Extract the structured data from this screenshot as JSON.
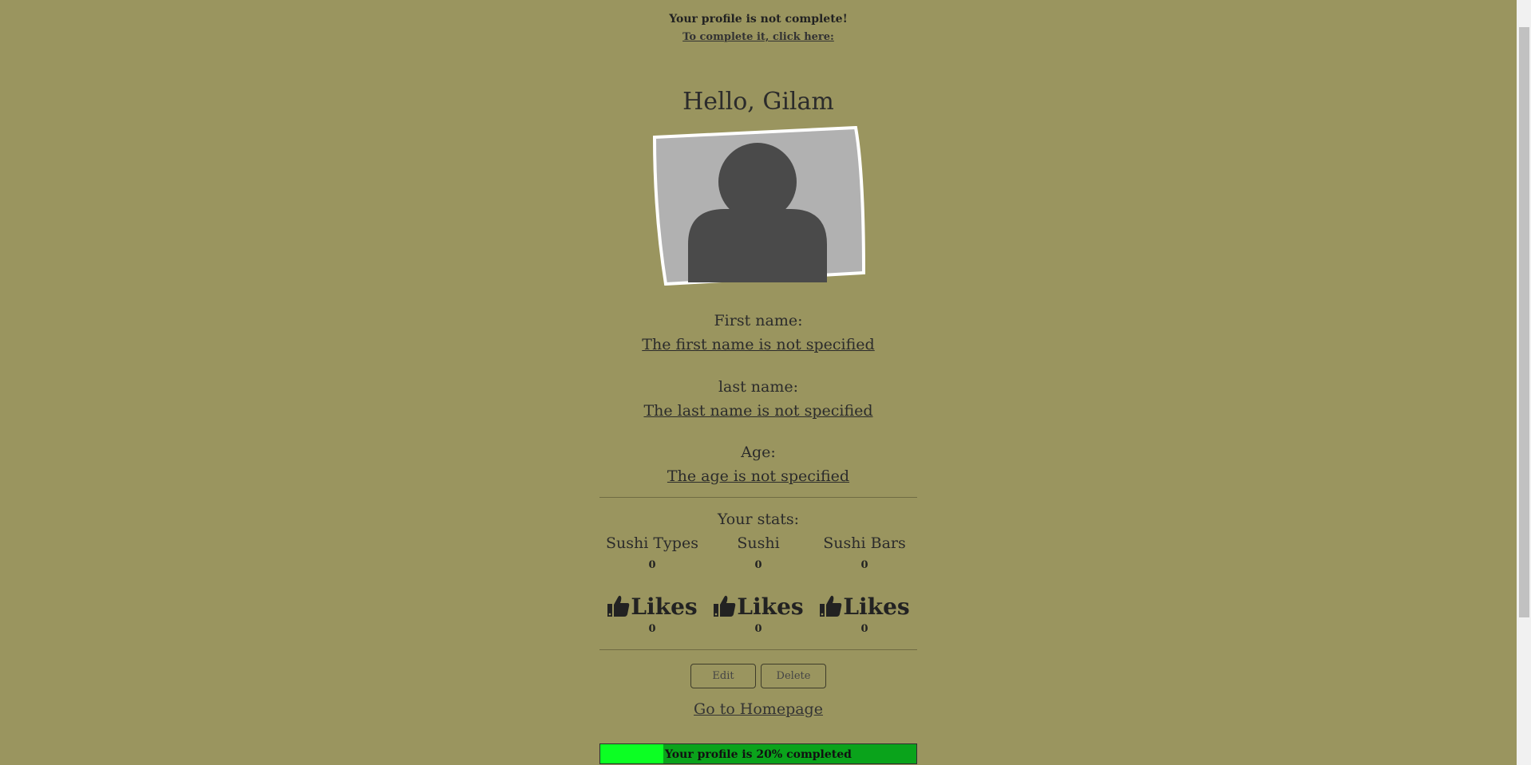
{
  "notice": {
    "message": "Your profile is not complete!",
    "link": "To complete it, click here:"
  },
  "greeting": "Hello, Gilam",
  "profile": {
    "first_name_label": "First name:",
    "first_name_value": "The first name is not specified",
    "last_name_label": "last name:",
    "last_name_value": "The last name is not specified",
    "age_label": "Age:",
    "age_value": "The age is not specified"
  },
  "stats": {
    "title": "Your stats:",
    "columns": [
      {
        "label": "Sushi Types",
        "count": "0",
        "likes_label": "Likes",
        "likes": "0"
      },
      {
        "label": "Sushi",
        "count": "0",
        "likes_label": "Likes",
        "likes": "0"
      },
      {
        "label": "Sushi Bars",
        "count": "0",
        "likes_label": "Likes",
        "likes": "0"
      }
    ]
  },
  "actions": {
    "edit_label": "Edit",
    "delete_label": "Delete",
    "home_link": "Go to Homepage"
  },
  "progress": {
    "percent": 20,
    "text": "Your profile is 20% completed"
  },
  "colors": {
    "background": "#9a955f",
    "progress_bar": "#0aa31b",
    "progress_fill": "#0cff23"
  },
  "icons": {
    "like": "thumbs-up-icon",
    "avatar": "user-silhouette-icon"
  }
}
